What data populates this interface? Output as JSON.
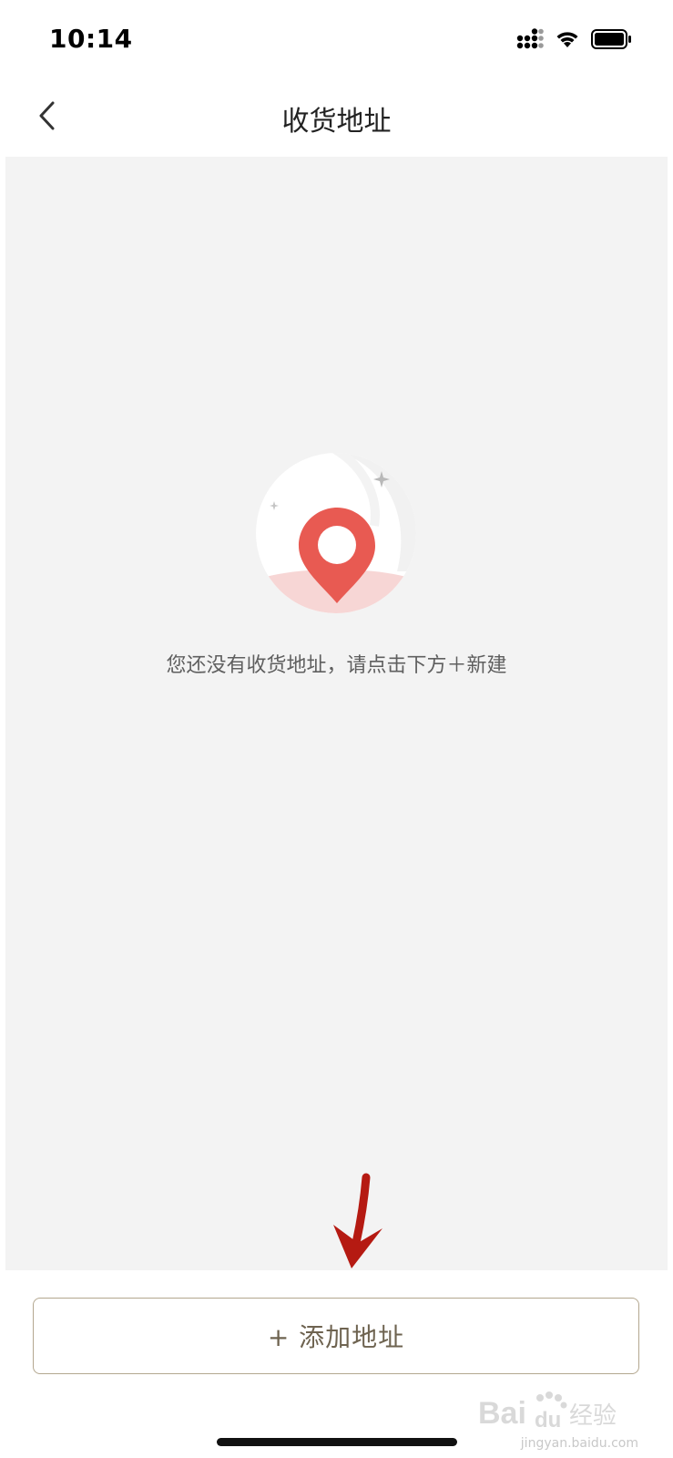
{
  "status_bar": {
    "time": "10:14",
    "icons": [
      "cellular-signal-icon",
      "wifi-icon",
      "battery-icon"
    ]
  },
  "nav": {
    "title": "收货地址",
    "back_icon": "chevron-left-icon"
  },
  "empty_state": {
    "illustration": "location-pin-icon",
    "message": "您还没有收货地址，请点击下方＋新建"
  },
  "add_button": {
    "label": "+ 添加地址"
  },
  "watermark": {
    "brand": "Bai",
    "brand_suffix": "du",
    "chinese": "经验",
    "url": "jingyan.baidu.com"
  },
  "colors": {
    "pin_red": "#e85a52",
    "content_bg": "#f3f3f3",
    "button_border": "#b3a78f",
    "button_text": "#6e6350",
    "annotation_arrow": "#b51a12"
  }
}
